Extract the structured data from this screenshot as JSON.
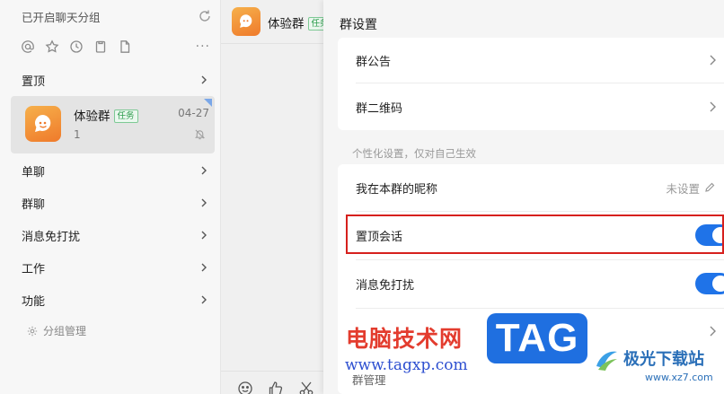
{
  "sidebar": {
    "header_title": "已开启聊天分组",
    "toolbar_more": "···",
    "groups": {
      "pinned": "置顶",
      "single": "单聊",
      "group": "群聊",
      "dnd": "消息免打扰",
      "work": "工作",
      "function": "功能"
    },
    "chat": {
      "name": "体验群",
      "tag": "任务",
      "date": "04-27",
      "count": "1"
    },
    "group_management": "分组管理"
  },
  "middle": {
    "title": "体验群",
    "tag": "任务"
  },
  "panel": {
    "title": "群设置",
    "announcement": "群公告",
    "qrcode": "群二维码",
    "section_hint": "个性化设置，仅对自己生效",
    "nickname_label": "我在本群的昵称",
    "nickname_value": "未设置",
    "pin_chat": "置顶会话",
    "pin_chat_on": true,
    "dnd": "消息免打扰",
    "dnd_on": true,
    "bottom_partial": "群管理"
  },
  "watermark": {
    "cn_title": "电脑技术网",
    "url": "www.tagxp.com",
    "tag": "TAG",
    "site_name": "极光下载站",
    "site_url": "www.xz7.com"
  },
  "colors": {
    "accent": "#1f73e8",
    "highlight_border": "#d6201d",
    "avatar": "#f08a33"
  }
}
